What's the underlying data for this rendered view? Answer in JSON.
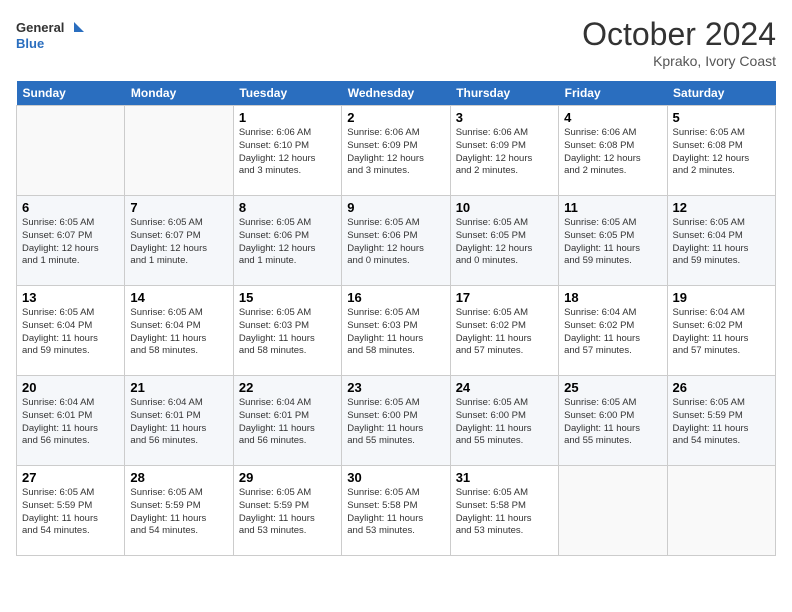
{
  "header": {
    "logo_line1": "General",
    "logo_line2": "Blue",
    "month": "October 2024",
    "location": "Kprako, Ivory Coast"
  },
  "days_of_week": [
    "Sunday",
    "Monday",
    "Tuesday",
    "Wednesday",
    "Thursday",
    "Friday",
    "Saturday"
  ],
  "weeks": [
    [
      {
        "day": "",
        "info": ""
      },
      {
        "day": "",
        "info": ""
      },
      {
        "day": "1",
        "info": "Sunrise: 6:06 AM\nSunset: 6:10 PM\nDaylight: 12 hours\nand 3 minutes."
      },
      {
        "day": "2",
        "info": "Sunrise: 6:06 AM\nSunset: 6:09 PM\nDaylight: 12 hours\nand 3 minutes."
      },
      {
        "day": "3",
        "info": "Sunrise: 6:06 AM\nSunset: 6:09 PM\nDaylight: 12 hours\nand 2 minutes."
      },
      {
        "day": "4",
        "info": "Sunrise: 6:06 AM\nSunset: 6:08 PM\nDaylight: 12 hours\nand 2 minutes."
      },
      {
        "day": "5",
        "info": "Sunrise: 6:05 AM\nSunset: 6:08 PM\nDaylight: 12 hours\nand 2 minutes."
      }
    ],
    [
      {
        "day": "6",
        "info": "Sunrise: 6:05 AM\nSunset: 6:07 PM\nDaylight: 12 hours\nand 1 minute."
      },
      {
        "day": "7",
        "info": "Sunrise: 6:05 AM\nSunset: 6:07 PM\nDaylight: 12 hours\nand 1 minute."
      },
      {
        "day": "8",
        "info": "Sunrise: 6:05 AM\nSunset: 6:06 PM\nDaylight: 12 hours\nand 1 minute."
      },
      {
        "day": "9",
        "info": "Sunrise: 6:05 AM\nSunset: 6:06 PM\nDaylight: 12 hours\nand 0 minutes."
      },
      {
        "day": "10",
        "info": "Sunrise: 6:05 AM\nSunset: 6:05 PM\nDaylight: 12 hours\nand 0 minutes."
      },
      {
        "day": "11",
        "info": "Sunrise: 6:05 AM\nSunset: 6:05 PM\nDaylight: 11 hours\nand 59 minutes."
      },
      {
        "day": "12",
        "info": "Sunrise: 6:05 AM\nSunset: 6:04 PM\nDaylight: 11 hours\nand 59 minutes."
      }
    ],
    [
      {
        "day": "13",
        "info": "Sunrise: 6:05 AM\nSunset: 6:04 PM\nDaylight: 11 hours\nand 59 minutes."
      },
      {
        "day": "14",
        "info": "Sunrise: 6:05 AM\nSunset: 6:04 PM\nDaylight: 11 hours\nand 58 minutes."
      },
      {
        "day": "15",
        "info": "Sunrise: 6:05 AM\nSunset: 6:03 PM\nDaylight: 11 hours\nand 58 minutes."
      },
      {
        "day": "16",
        "info": "Sunrise: 6:05 AM\nSunset: 6:03 PM\nDaylight: 11 hours\nand 58 minutes."
      },
      {
        "day": "17",
        "info": "Sunrise: 6:05 AM\nSunset: 6:02 PM\nDaylight: 11 hours\nand 57 minutes."
      },
      {
        "day": "18",
        "info": "Sunrise: 6:04 AM\nSunset: 6:02 PM\nDaylight: 11 hours\nand 57 minutes."
      },
      {
        "day": "19",
        "info": "Sunrise: 6:04 AM\nSunset: 6:02 PM\nDaylight: 11 hours\nand 57 minutes."
      }
    ],
    [
      {
        "day": "20",
        "info": "Sunrise: 6:04 AM\nSunset: 6:01 PM\nDaylight: 11 hours\nand 56 minutes."
      },
      {
        "day": "21",
        "info": "Sunrise: 6:04 AM\nSunset: 6:01 PM\nDaylight: 11 hours\nand 56 minutes."
      },
      {
        "day": "22",
        "info": "Sunrise: 6:04 AM\nSunset: 6:01 PM\nDaylight: 11 hours\nand 56 minutes."
      },
      {
        "day": "23",
        "info": "Sunrise: 6:05 AM\nSunset: 6:00 PM\nDaylight: 11 hours\nand 55 minutes."
      },
      {
        "day": "24",
        "info": "Sunrise: 6:05 AM\nSunset: 6:00 PM\nDaylight: 11 hours\nand 55 minutes."
      },
      {
        "day": "25",
        "info": "Sunrise: 6:05 AM\nSunset: 6:00 PM\nDaylight: 11 hours\nand 55 minutes."
      },
      {
        "day": "26",
        "info": "Sunrise: 6:05 AM\nSunset: 5:59 PM\nDaylight: 11 hours\nand 54 minutes."
      }
    ],
    [
      {
        "day": "27",
        "info": "Sunrise: 6:05 AM\nSunset: 5:59 PM\nDaylight: 11 hours\nand 54 minutes."
      },
      {
        "day": "28",
        "info": "Sunrise: 6:05 AM\nSunset: 5:59 PM\nDaylight: 11 hours\nand 54 minutes."
      },
      {
        "day": "29",
        "info": "Sunrise: 6:05 AM\nSunset: 5:59 PM\nDaylight: 11 hours\nand 53 minutes."
      },
      {
        "day": "30",
        "info": "Sunrise: 6:05 AM\nSunset: 5:58 PM\nDaylight: 11 hours\nand 53 minutes."
      },
      {
        "day": "31",
        "info": "Sunrise: 6:05 AM\nSunset: 5:58 PM\nDaylight: 11 hours\nand 53 minutes."
      },
      {
        "day": "",
        "info": ""
      },
      {
        "day": "",
        "info": ""
      }
    ]
  ]
}
